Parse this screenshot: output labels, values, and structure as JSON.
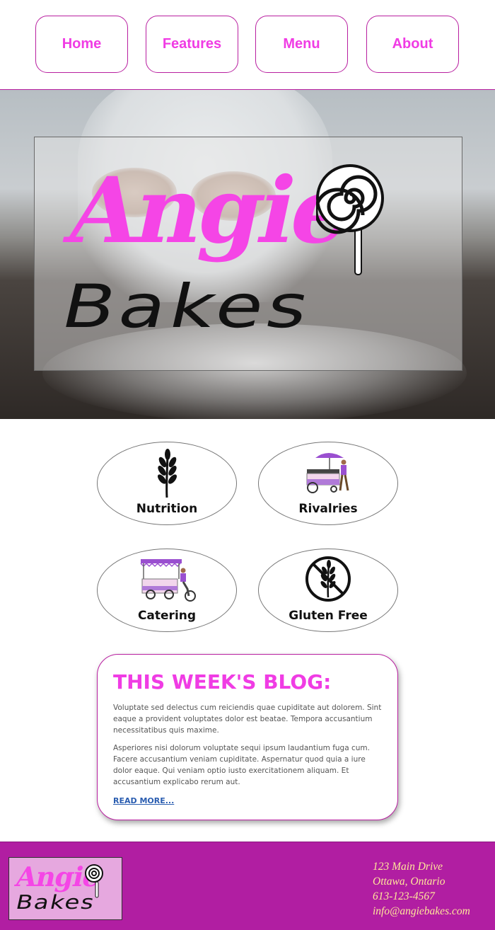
{
  "nav": {
    "items": [
      {
        "label": "Home"
      },
      {
        "label": "Features"
      },
      {
        "label": "Menu"
      },
      {
        "label": "About"
      }
    ]
  },
  "hero": {
    "logo_top": "Angie",
    "logo_bottom": "Bakes",
    "logo_colors": {
      "angie": "#f545e6",
      "bakes": "#111111"
    }
  },
  "features": [
    {
      "label": "Nutrition",
      "icon": "wheat-icon"
    },
    {
      "label": "Rivalries",
      "icon": "food-cart-icon"
    },
    {
      "label": "Catering",
      "icon": "bike-cart-icon"
    },
    {
      "label": "Gluten Free",
      "icon": "no-gluten-icon"
    }
  ],
  "blog": {
    "title": "THIS WEEK'S BLOG:",
    "paragraphs": [
      "Voluptate sed delectus cum reiciendis quae cupiditate aut dolorem. Sint eaque a provident voluptates dolor est beatae. Tempora accusantium necessitatibus quis maxime.",
      "Asperiores nisi dolorum voluptate sequi ipsum laudantium fuga cum. Facere accusantium veniam cupiditate. Aspernatur quod quia a iure dolor eaque. Qui veniam optio iusto exercitationem aliquam. Et accusantium explicabo rerum aut."
    ],
    "read_more": "READ MORE..."
  },
  "footer": {
    "logo_top": "Angie",
    "logo_bottom": "Bakes",
    "address_line1": "123 Main Drive",
    "address_line2": "Ottawa, Ontario",
    "phone": "613-123-4567",
    "email": "info@angiebakes.com"
  },
  "colors": {
    "accent": "#f03ce4",
    "border": "#b81fa0",
    "footer_bg": "#b11ea2",
    "footer_text": "#ffe79a",
    "link": "#2a5db0"
  }
}
